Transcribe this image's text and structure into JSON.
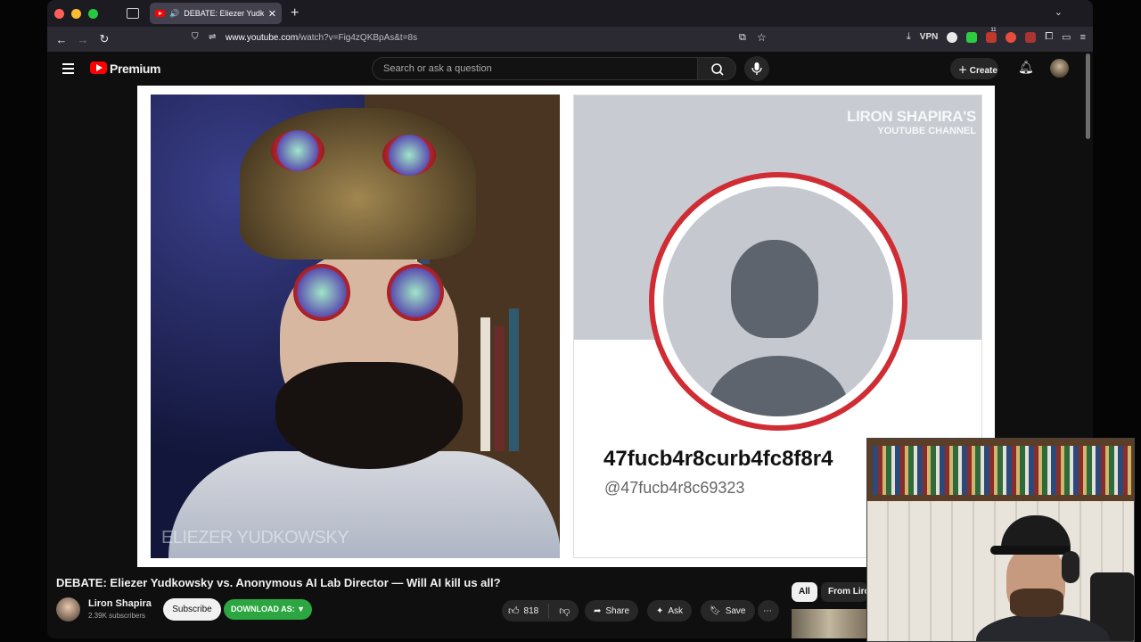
{
  "browser": {
    "tab_title": "DEBATE: Eliezer Yudkowsky",
    "url_host": "www.youtube.com",
    "url_path": "/watch?v=Fig4zQKBpAs&t=8s",
    "vpn_label": "VPN",
    "ext_badge": "11"
  },
  "youtube": {
    "logo_label": "Premium",
    "search_placeholder": "Search or ask a question",
    "create_label": "Create"
  },
  "video": {
    "left_name_overlay": "ELIEZER YUDKOWSKY",
    "watermark_line1": "LIRON SHAPIRA'S",
    "watermark_line2": "YOUTUBE CHANNEL",
    "profile_name": "47fucb4r8curb4fc8f8r4",
    "profile_handle": "@47fucb4r8c69323"
  },
  "meta": {
    "title": "DEBATE: Eliezer Yudkowsky vs. Anonymous AI Lab Director — Will AI kill us all?",
    "channel_name": "Liron Shapira",
    "subscribers": "2.39K subscribers",
    "subscribe_label": "Subscribe",
    "download_label": "DOWNLOAD AS: ▼",
    "likes": "818",
    "share_label": "Share",
    "ask_label": "Ask",
    "save_label": "Save",
    "more_label": "⋯"
  },
  "chips": {
    "all": "All",
    "from": "From Liron"
  },
  "colors": {
    "accent_red": "#ff0000",
    "download_green": "#2ba640",
    "ring_red": "#cf2c33"
  }
}
